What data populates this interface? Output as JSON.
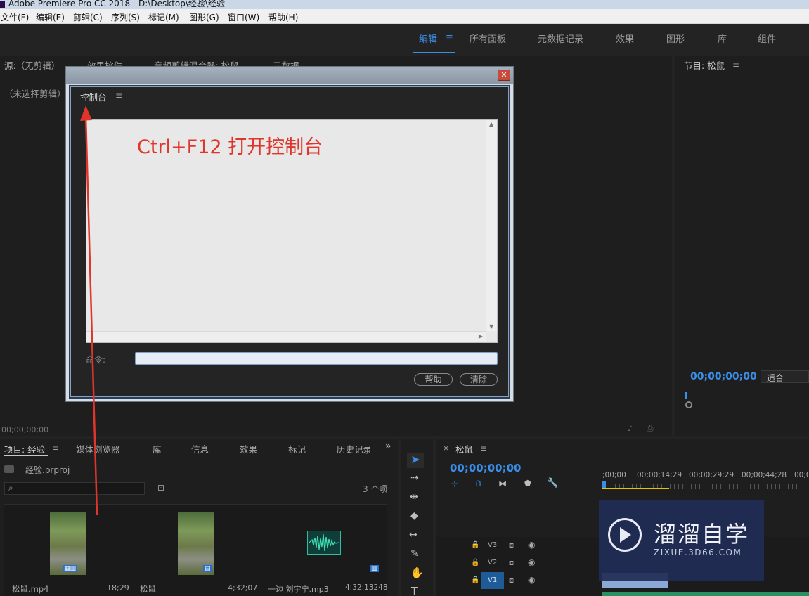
{
  "window": {
    "title": "Adobe Premiere Pro CC 2018 - D:\\Desktop\\经验\\经验"
  },
  "menu": [
    "文件(F)",
    "编辑(E)",
    "剪辑(C)",
    "序列(S)",
    "标记(M)",
    "图形(G)",
    "窗口(W)",
    "帮助(H)"
  ],
  "workspaces": {
    "active": "编辑",
    "items": [
      "所有面板",
      "元数据记录",
      "效果",
      "图形",
      "库",
      "组件"
    ]
  },
  "source_panel": {
    "tabs": [
      "源:（无剪辑）",
      "效果控件",
      "音频剪辑混合器: 松鼠",
      "元数据"
    ],
    "no_clip": "（未选择剪辑）",
    "timecode": "00;00;00;00"
  },
  "program_panel": {
    "title": "节目: 松鼠",
    "timecode": "00;00;00;00",
    "fit": "适合"
  },
  "console_dialog": {
    "panel_title": "控制台",
    "annotation": "Ctrl+F12 打开控制台",
    "command_label": "命令:",
    "command_value": "",
    "help_button": "帮助",
    "clear_button": "清除"
  },
  "project_panel": {
    "tabs": [
      "项目: 经验",
      "媒体浏览器",
      "库",
      "信息",
      "效果",
      "标记",
      "历史记录"
    ],
    "project_file": "经验.prproj",
    "item_count": "3 个项",
    "items": [
      {
        "name": "松鼠.mp4",
        "duration": "18;29"
      },
      {
        "name": "松鼠",
        "duration": "4;32;07"
      },
      {
        "name": "一边 刘宇宁.mp3",
        "duration": "4:32:13248"
      }
    ]
  },
  "timeline": {
    "sequence": "松鼠",
    "timecode": "00;00;00;00",
    "ruler": [
      ";00;00",
      "00;00;14;29",
      "00;00;29;29",
      "00;00;44;28",
      "00;0"
    ],
    "tracks": [
      "V3",
      "V2",
      "V1"
    ]
  },
  "watermark": {
    "brand": "溜溜自学",
    "url": "ZIXUE.3D66.COM"
  },
  "colors": {
    "accent": "#3b8ee8",
    "annotation": "#e0352b",
    "panel_bg": "#1e1e1e"
  }
}
